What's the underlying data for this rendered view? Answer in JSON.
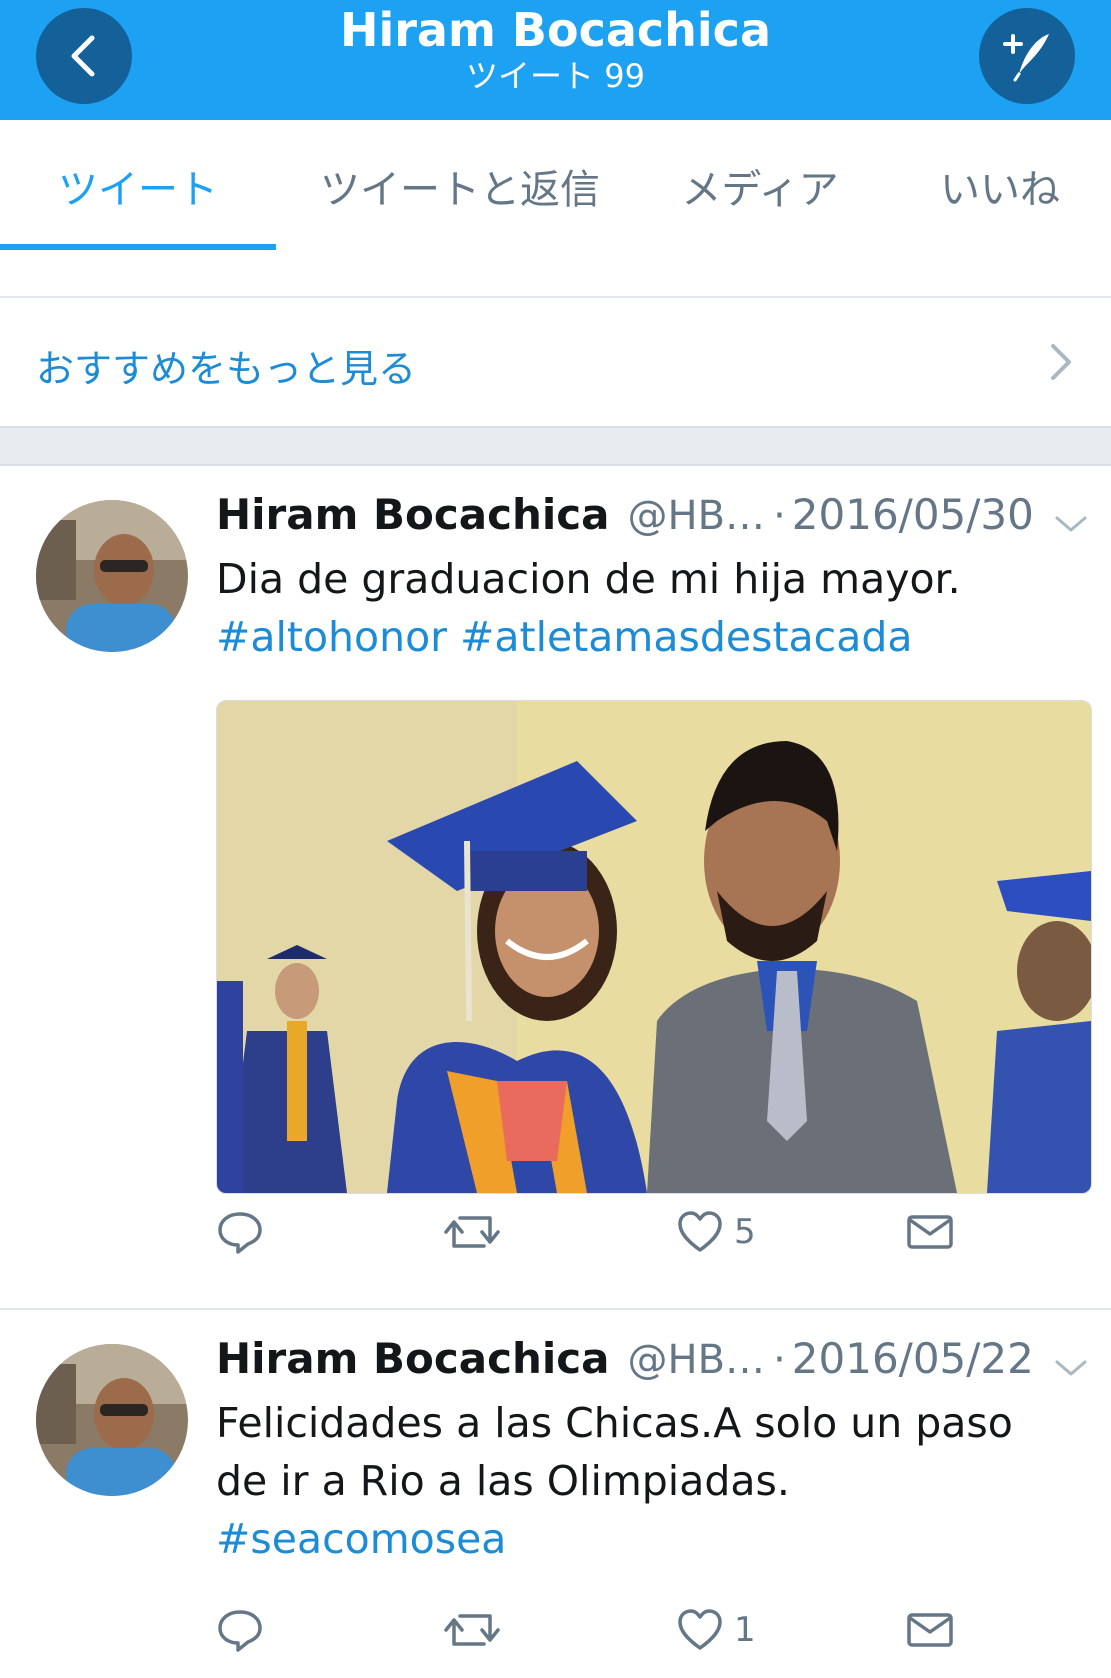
{
  "header": {
    "title": "Hiram Bocachica",
    "subtitle": "ツイート 99",
    "back_icon": "chevron-left-icon",
    "compose_icon": "compose-tweet-icon",
    "bg_color": "#1da1f2"
  },
  "tabs": [
    {
      "label": "ツイート",
      "active": true
    },
    {
      "label": "ツイートと返信",
      "active": false
    },
    {
      "label": "メディア",
      "active": false
    },
    {
      "label": "いいね",
      "active": false
    }
  ],
  "recommend": {
    "label": "おすすめをもっと見る"
  },
  "tweets": [
    {
      "name": "Hiram Bocachica",
      "handle": "@HB…",
      "dot": "·",
      "date": "2016/05/30",
      "text": "Dia de graduacion de mi hija mayor.",
      "hashtags": "#altohonor #atletamasdestacada",
      "reply_count": "",
      "retweet_count": "",
      "like_count": "5"
    },
    {
      "name": "Hiram Bocachica",
      "handle": "@HB…",
      "dot": "·",
      "date": "2016/05/22",
      "text_line1": "Felicidades a las Chicas.A solo un paso",
      "text_line2": "de ir a Rio a las Olimpiadas.",
      "hashtags": "#seacomosea",
      "reply_count": "",
      "retweet_count": "",
      "like_count": "1"
    }
  ],
  "colors": {
    "accent": "#1da1f2",
    "link": "#1d8cd6",
    "muted": "#657786",
    "text": "#14171a"
  }
}
